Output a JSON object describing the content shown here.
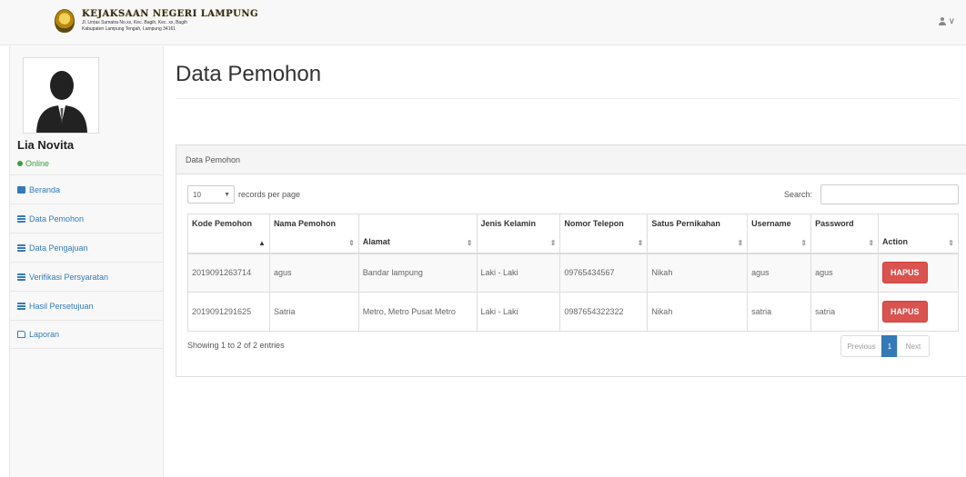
{
  "header": {
    "logo_title": "KEJAKSAAN NEGERI LAMPUNG",
    "logo_subtitle": "Jl. Lintas Sumatra No.xx, Kec. Bagih, Kec. xx, Bagih",
    "logo_subtitle2": "Kabupaten Lampung Tengah, Lampung 34161",
    "user_caret": "∨"
  },
  "sidebar": {
    "user_name": "Lia Novita",
    "status": "Online",
    "items": [
      {
        "label": "Beranda",
        "icon": "dashboard-icon"
      },
      {
        "label": "Data Pemohon",
        "icon": "table-icon"
      },
      {
        "label": "Data Pengajuan",
        "icon": "table-icon"
      },
      {
        "label": "Verifikasi Persyaratan",
        "icon": "table-icon"
      },
      {
        "label": "Hasil Persetujuan",
        "icon": "table-icon"
      },
      {
        "label": "Laporan",
        "icon": "folder-icon"
      }
    ]
  },
  "main": {
    "page_title": "Data Pemohon",
    "panel_title": "Data Pemohon",
    "length_value": "10",
    "length_suffix": "records per page",
    "search_label": "Search:",
    "search_value": "",
    "columns": [
      "Kode Pemohon",
      "Nama Pemohon",
      "Alamat",
      "Jenis Kelamin",
      "Nomor Telepon",
      "Satus Pernikahan",
      "Username",
      "Password",
      "Action"
    ],
    "rows": [
      {
        "kode": "2019091263714",
        "nama": "agus",
        "alamat": "Bandar lampung",
        "jk": "Laki - Laki",
        "telp": "09765434567",
        "status": "Nikah",
        "username": "agus",
        "password": "agus",
        "action": "HAPUS"
      },
      {
        "kode": "2019091291625",
        "nama": "Satria",
        "alamat": "Metro, Metro Pusat Metro",
        "jk": "Laki - Laki",
        "telp": "0987654322322",
        "status": "Nikah",
        "username": "satria",
        "password": "satria",
        "action": "HAPUS"
      }
    ],
    "info": "Showing 1 to 2 of 2 entries",
    "pagination": {
      "prev": "Previous",
      "current": "1",
      "next": "Next"
    }
  }
}
